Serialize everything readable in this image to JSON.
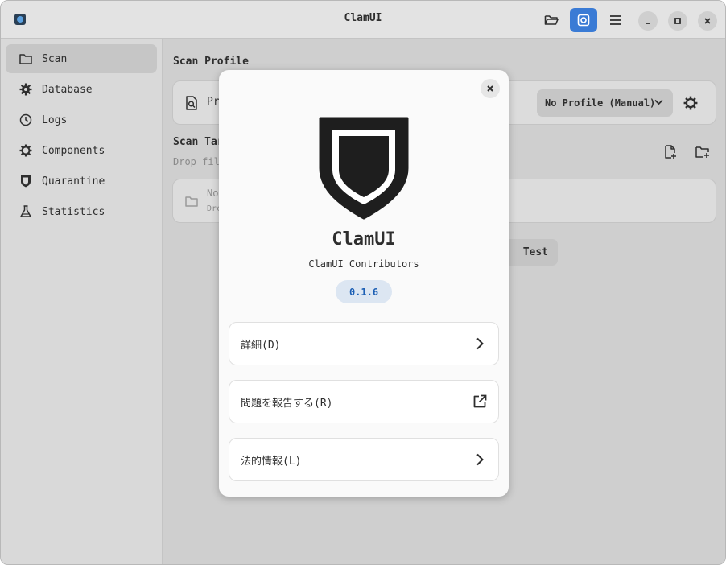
{
  "window": {
    "title": "ClamUI"
  },
  "sidebar": {
    "items": [
      {
        "label": "Scan",
        "icon": "folder-icon"
      },
      {
        "label": "Database",
        "icon": "gear-icon"
      },
      {
        "label": "Logs",
        "icon": "clock-icon"
      },
      {
        "label": "Components",
        "icon": "gear-icon"
      },
      {
        "label": "Quarantine",
        "icon": "shield-icon"
      },
      {
        "label": "Statistics",
        "icon": "flask-icon"
      }
    ]
  },
  "main": {
    "scan_profile_title": "Scan Profile",
    "profile_label_partial": "Pr",
    "profile_dropdown": "No Profile (Manual)",
    "scan_targets_title_partial": "Scan Targ",
    "drop_hint_partial": "Drop file",
    "target_empty_partial": "No",
    "target_sub_partial": "Drc",
    "test_button_partial": "Test"
  },
  "about_dialog": {
    "app_name": "ClamUI",
    "developer": "ClamUI Contributors",
    "version": "0.1.6",
    "rows": [
      {
        "label": "詳細(D)",
        "icon": "chevron-right-icon"
      },
      {
        "label": "問題を報告する(R)",
        "icon": "external-link-icon"
      },
      {
        "label": "法的情報(L)",
        "icon": "chevron-right-icon"
      }
    ]
  },
  "colors": {
    "accent": "#3a7bd5",
    "version_badge_bg": "#dce6f2",
    "version_badge_text": "#1c5fb4"
  }
}
